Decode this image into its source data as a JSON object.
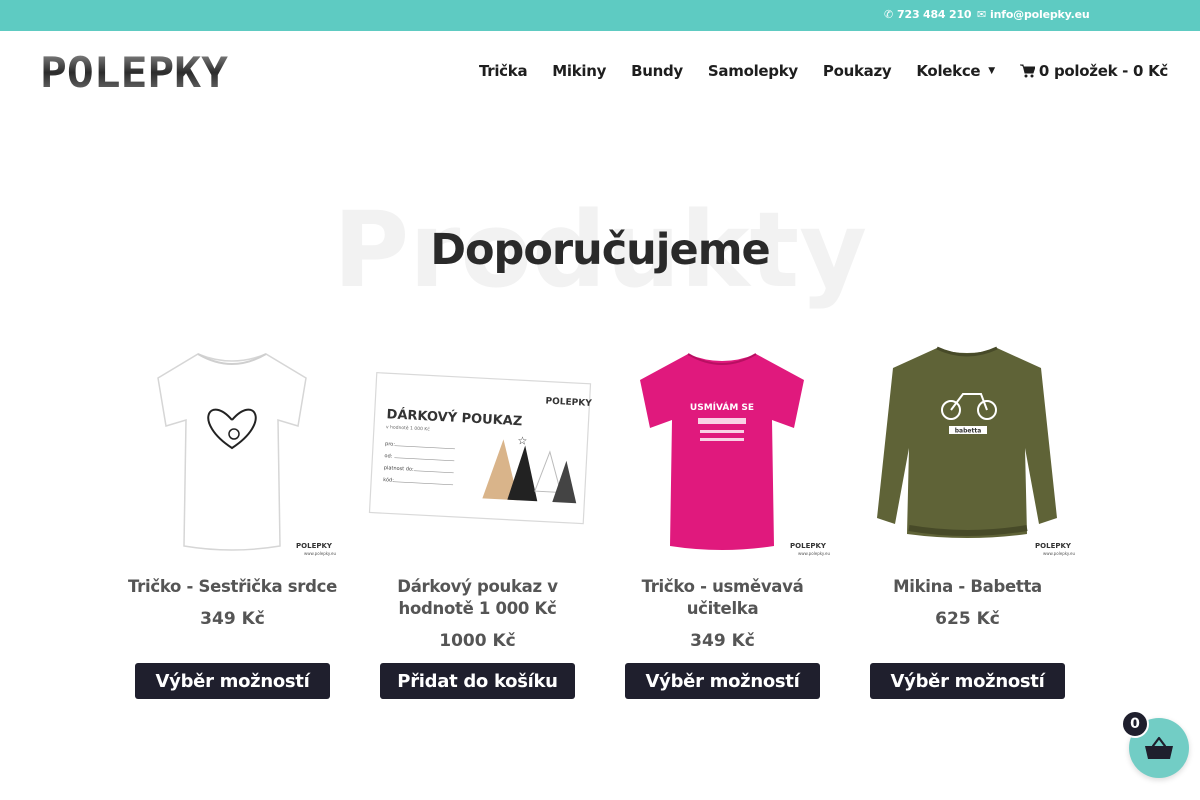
{
  "topbar": {
    "phone": "723 484 210",
    "email": "info@polepky.eu",
    "background": "#5ecbc2"
  },
  "header": {
    "logo_text": "POLEPKY",
    "nav": [
      {
        "label": "Trička"
      },
      {
        "label": "Mikiny"
      },
      {
        "label": "Bundy"
      },
      {
        "label": "Samolepky"
      },
      {
        "label": "Poukazy"
      },
      {
        "label": "Kolekce"
      }
    ],
    "cart_label": "0 položek - 0 Kč"
  },
  "section": {
    "background_title": "Produkty",
    "title": "Doporučujeme"
  },
  "products": [
    {
      "name": "Tričko - Sestřička srdce",
      "price": "349 Kč",
      "button": "Výběr možností",
      "image": "white-tshirt-nurse-heart",
      "brand_mark": "POLEPKY",
      "brand_url": "www.polepky.eu"
    },
    {
      "name": "Dárkový poukaz v hodnotě 1 000 Kč",
      "price": "1000 Kč",
      "button": "Přidat do košíku",
      "image": "gift-voucher-card",
      "voucher_title": "DÁRKOVÝ POUKAZ",
      "voucher_brand": "POLEPKY",
      "voucher_sub": "v hodnotě 1 000 Kč",
      "voucher_fields": [
        "pro:",
        "od:",
        "platnost do:",
        "kód:"
      ]
    },
    {
      "name": "Tričko - usměvavá učitelka",
      "price": "349 Kč",
      "button": "Výběr možností",
      "image": "pink-tshirt-teacher",
      "shirt_text": "USMÍVÁM SE",
      "brand_mark": "POLEPKY",
      "brand_url": "www.polepky.eu"
    },
    {
      "name": "Mikina - Babetta",
      "price": "625 Kč",
      "button": "Výběr možností",
      "image": "olive-sweatshirt-babetta",
      "shirt_text": "babetta",
      "brand_mark": "POLEPKY",
      "brand_url": "www.polepky.eu"
    }
  ],
  "floating_cart": {
    "count": "0",
    "accent": "#72cdc5"
  },
  "colors": {
    "button_bg": "#1f1f2d",
    "accent": "#5ecbc2"
  }
}
